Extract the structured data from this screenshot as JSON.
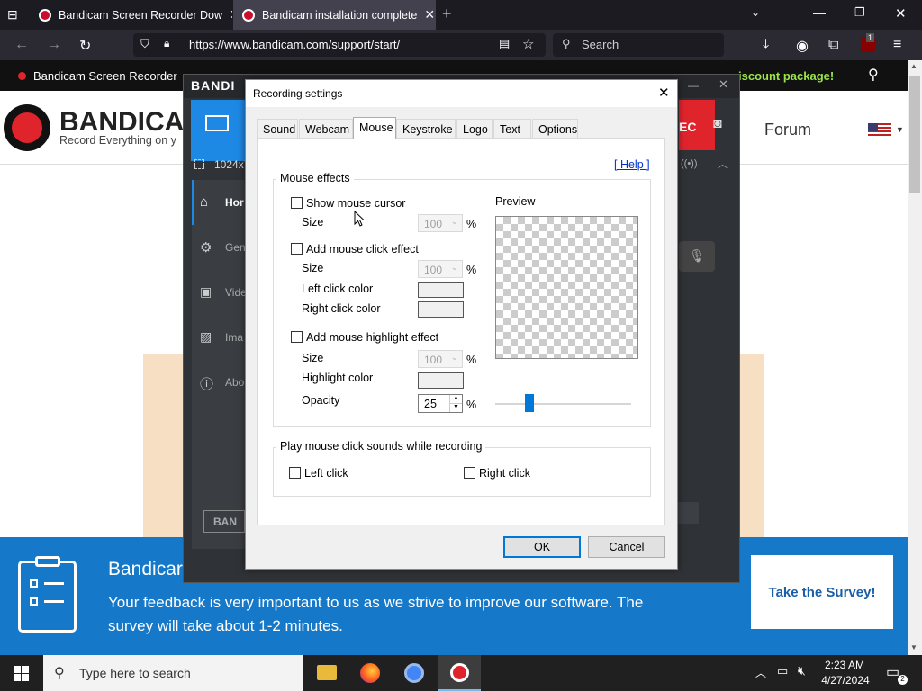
{
  "browser": {
    "tabs": [
      {
        "title": "Bandicam Screen Recorder Dow",
        "active": false
      },
      {
        "title": "Bandicam installation complete",
        "active": true
      }
    ],
    "url": "https://www.bandicam.com/support/start/",
    "search_placeholder": "Search",
    "extension_badge": "1"
  },
  "site": {
    "topbar_title": "Bandicam Screen Recorder",
    "promo": "iscount package!",
    "logo_text": "BANDICA",
    "tagline": "Record Everything on y",
    "forum": "Forum"
  },
  "app": {
    "logo": "BANDI",
    "resolution": "1024x7",
    "nav": [
      "Hor",
      "Gen",
      "Vide",
      "Ima",
      "Abo"
    ],
    "bottom_logo": "BAN"
  },
  "dialog": {
    "title": "Recording settings",
    "tabs": [
      "Sound",
      "Webcam",
      "Mouse",
      "Keystroke",
      "Logo",
      "Text",
      "Options"
    ],
    "selected_tab": "Mouse",
    "help": "[ Help ]",
    "mouse_effects": {
      "title": "Mouse effects",
      "show_cursor": "Show mouse cursor",
      "size_label": "Size",
      "size_value": "100",
      "percent": "%",
      "click_effect": "Add mouse click effect",
      "left_click_color": "Left click color",
      "right_click_color": "Right click color",
      "highlight_effect": "Add mouse highlight effect",
      "highlight_color": "Highlight color",
      "opacity_label": "Opacity",
      "opacity_value": "25",
      "preview_label": "Preview"
    },
    "click_sounds": {
      "title": "Play mouse click sounds while recording",
      "left": "Left click",
      "right": "Right click"
    },
    "ok": "OK",
    "cancel": "Cancel"
  },
  "survey": {
    "title": "Bandicar",
    "text_line1": "Your feedback is very important to us as we strive to improve our software. The",
    "text_line2": "survey will take about 1-2 minutes.",
    "button": "Take the Survey!"
  },
  "taskbar": {
    "search_placeholder": "Type here to search",
    "time": "2:23 AM",
    "date": "4/27/2024"
  },
  "colors": {
    "survey_blue": "#1578c8",
    "app_blue": "#1e88e5",
    "brand_red": "#e0242c"
  }
}
